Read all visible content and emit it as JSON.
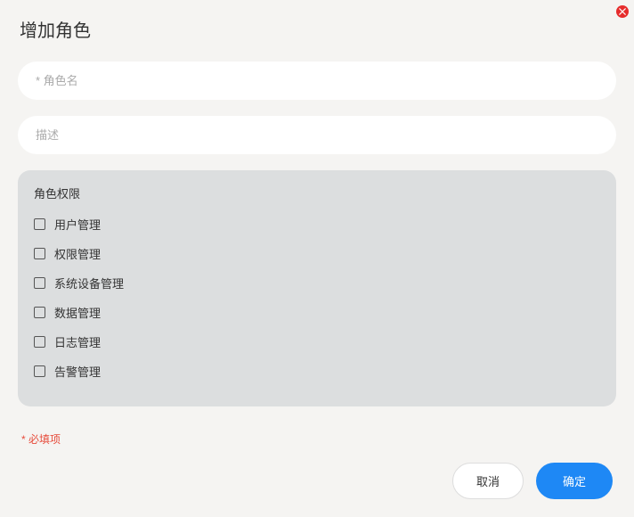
{
  "dialog": {
    "title": "增加角色",
    "close_icon": "close"
  },
  "fields": {
    "role_name": {
      "placeholder": "* 角色名",
      "value": ""
    },
    "description": {
      "placeholder": "描述",
      "value": ""
    }
  },
  "permissions": {
    "title": "角色权限",
    "items": [
      {
        "label": "用户管理",
        "checked": false
      },
      {
        "label": "权限管理",
        "checked": false
      },
      {
        "label": "系统设备管理",
        "checked": false
      },
      {
        "label": "数据管理",
        "checked": false
      },
      {
        "label": "日志管理",
        "checked": false
      },
      {
        "label": "告警管理",
        "checked": false
      }
    ]
  },
  "required_note": "* 必填项",
  "buttons": {
    "cancel": "取消",
    "confirm": "确定"
  }
}
